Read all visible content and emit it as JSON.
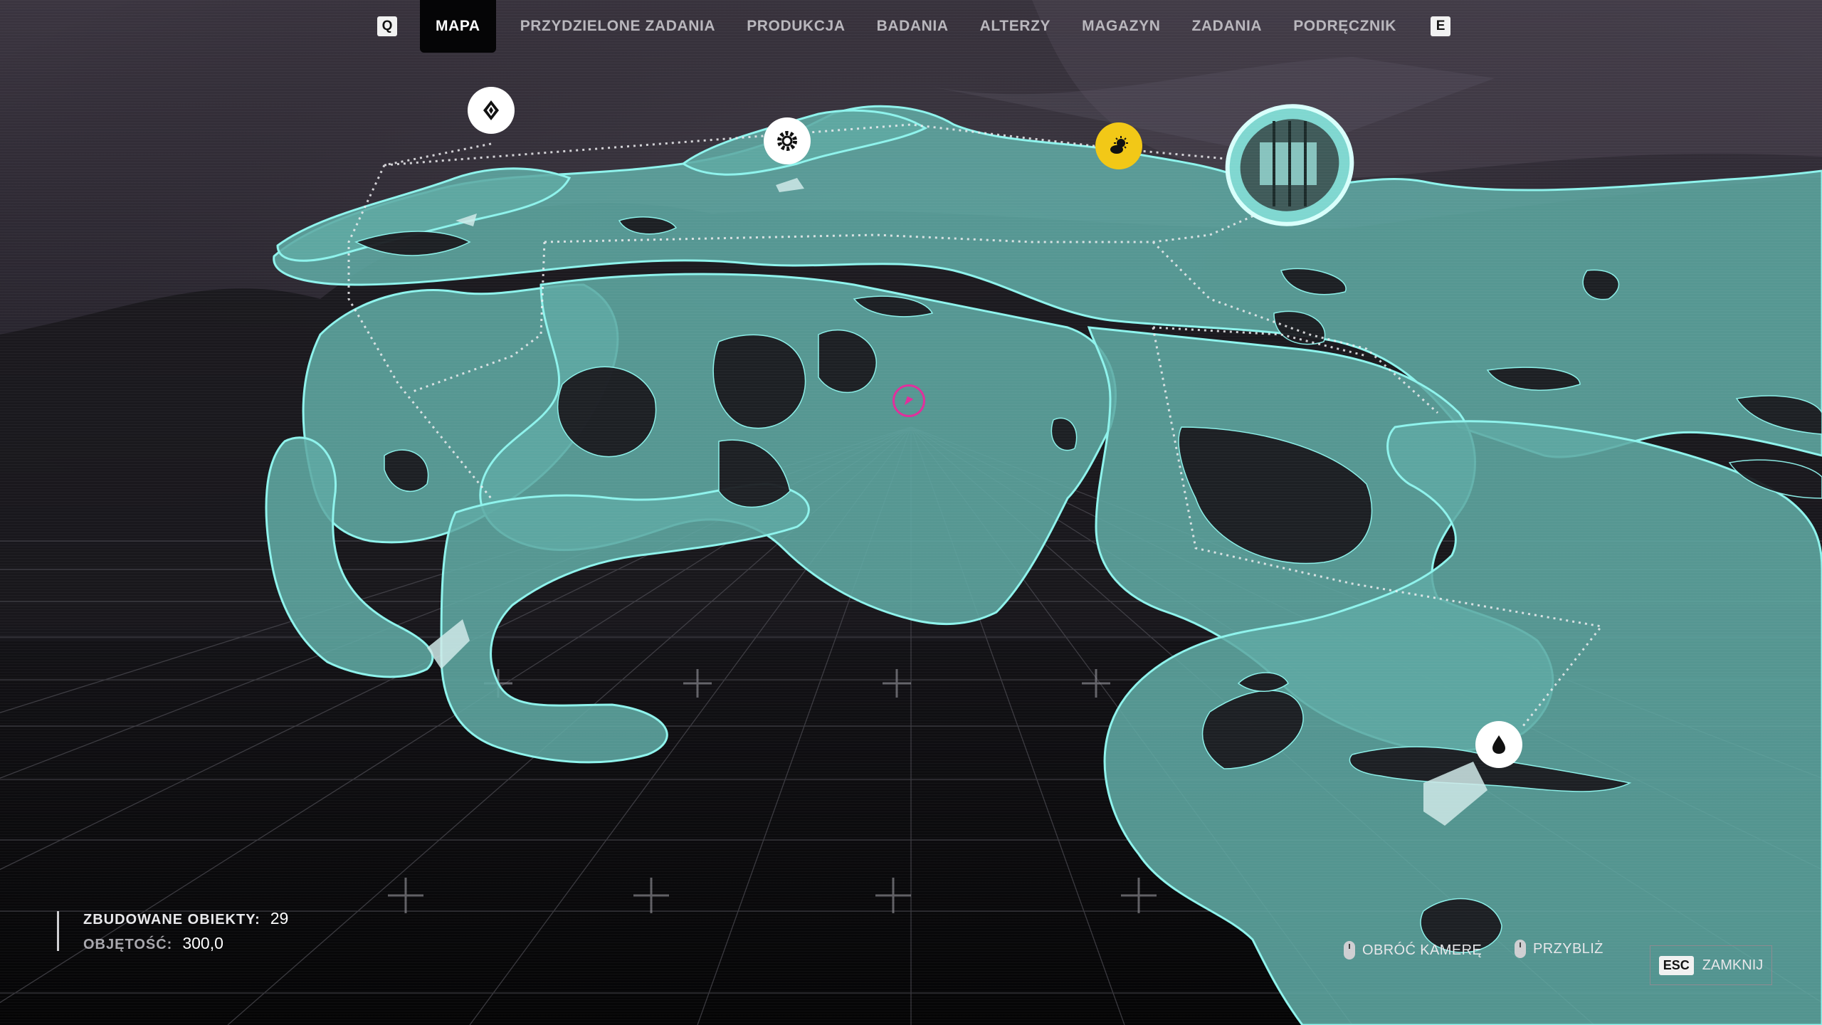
{
  "nav": {
    "prev_key": "Q",
    "next_key": "E",
    "tabs": [
      {
        "label": "MAPA",
        "active": true
      },
      {
        "label": "PRZYDZIELONE ZADANIA",
        "active": false
      },
      {
        "label": "PRODUKCJA",
        "active": false
      },
      {
        "label": "BADANIA",
        "active": false
      },
      {
        "label": "ALTERZY",
        "active": false
      },
      {
        "label": "MAGAZYN",
        "active": false
      },
      {
        "label": "ZADANIA",
        "active": false
      },
      {
        "label": "PODRĘCZNIK",
        "active": false
      }
    ]
  },
  "stats": {
    "built_label": "ZBUDOWANE OBIEKTY:",
    "built_value": "29",
    "volume_label": "OBJĘTOŚĆ:",
    "volume_value": "300,0"
  },
  "controls": {
    "rotate_label": "OBRÓĆ KAMERĘ",
    "zoom_label": "PRZYBLIŻ",
    "close_key": "ESC",
    "close_label": "ZAMKNIJ"
  },
  "map": {
    "pins": [
      {
        "name": "diamond-pin",
        "icon": "diamond-icon",
        "color": "#ffffff"
      },
      {
        "name": "gear-pin",
        "icon": "gear-icon",
        "color": "#ffffff"
      },
      {
        "name": "weather-pin",
        "icon": "sun-cloud-icon",
        "color": "#f2c817"
      },
      {
        "name": "drop-pin",
        "icon": "drop-icon",
        "color": "#ffffff"
      },
      {
        "name": "player-marker",
        "icon": "player-direction-icon",
        "color": "#e0309c"
      }
    ],
    "colors": {
      "land": "#5fa8a3",
      "land_edge": "#8ef3ec",
      "water_grid": "#000000",
      "sky": "#2e2a33"
    }
  }
}
